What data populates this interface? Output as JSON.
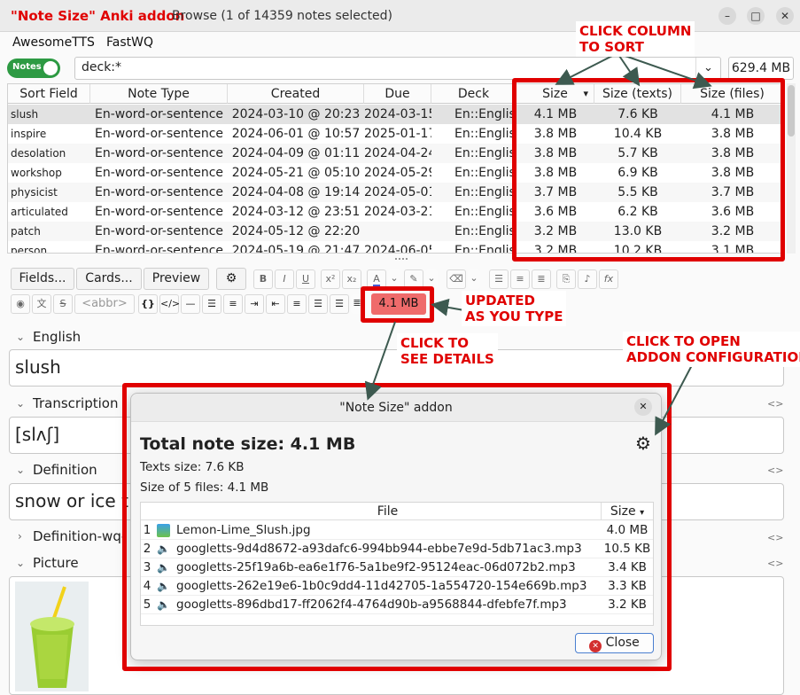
{
  "titlebar": {
    "addon_title": "\"Note Size\" Anki addon",
    "window_title": "Browse (1 of 14359 notes selected)",
    "minimize": "–",
    "maximize": "□",
    "close": "✕"
  },
  "menu": {
    "items": [
      "AwesomeTTS",
      "FastWQ"
    ]
  },
  "search": {
    "toggle_label": "Notes",
    "query": "deck:*",
    "dropdown_icon": "⌄",
    "total_size": "629.4 MB"
  },
  "table": {
    "headers": [
      "Sort Field",
      "Note Type",
      "Created",
      "Due",
      "Deck",
      "Size",
      "Size (texts)",
      "Size (files)"
    ],
    "sort_indicator": "▾",
    "rows": [
      [
        "slush",
        "En-word-or-sentence",
        "2024-03-10 @ 20:23",
        "2024-03-15",
        "En::English",
        "4.1 MB",
        "7.6 KB",
        "4.1 MB"
      ],
      [
        "inspire",
        "En-word-or-sentence",
        "2024-06-01 @ 10:57",
        "2025-01-17",
        "En::English",
        "3.8 MB",
        "10.4 KB",
        "3.8 MB"
      ],
      [
        "desolation",
        "En-word-or-sentence",
        "2024-04-09 @ 01:11",
        "2024-04-24",
        "En::English",
        "3.8 MB",
        "5.7 KB",
        "3.8 MB"
      ],
      [
        "workshop",
        "En-word-or-sentence",
        "2024-05-21 @ 05:10",
        "2024-05-29",
        "En::English",
        "3.8 MB",
        "6.9 KB",
        "3.8 MB"
      ],
      [
        "physicist",
        "En-word-or-sentence",
        "2024-04-08 @ 19:14",
        "2024-05-01",
        "En::English",
        "3.7 MB",
        "5.5 KB",
        "3.7 MB"
      ],
      [
        "articulated",
        "En-word-or-sentence",
        "2024-03-12 @ 23:51",
        "2024-03-21",
        "En::English",
        "3.6 MB",
        "6.2 KB",
        "3.6 MB"
      ],
      [
        "patch",
        "En-word-or-sentence",
        "2024-05-12 @ 22:20",
        "",
        "En::English",
        "3.2 MB",
        "13.0 KB",
        "3.2 MB"
      ],
      [
        "person",
        "En-word-or-sentence",
        "2024-05-19 @ 21:47",
        "2024-06-05",
        "En::English",
        "3.2 MB",
        "10.2 KB",
        "3.1 MB"
      ]
    ]
  },
  "editor_toolbar": {
    "fields_button": "Fields...",
    "cards_button": "Cards...",
    "preview_button": "Preview",
    "abbr_button": "<abbr>",
    "note_size_button": "4.1 MB"
  },
  "fields": [
    {
      "label": "English",
      "value": "slush"
    },
    {
      "label": "Transcription",
      "value": "[slʌʃ]"
    },
    {
      "label": "Definition",
      "value": "snow or ice t"
    },
    {
      "label": "Definition-wq-",
      "value": ""
    },
    {
      "label": "Picture",
      "value": ""
    }
  ],
  "annotations": {
    "sort": "CLICK COLUMN\nTO SORT",
    "updated": "UPDATED\nAS YOU TYPE",
    "details": "CLICK TO\nSEE DETAILS",
    "config": "CLICK TO OPEN\nADDON CONFIGURATION"
  },
  "dialog": {
    "title": "\"Note Size\" addon",
    "total": "Total note size: 4.1 MB",
    "texts": "Texts size: 7.6 KB",
    "files_summary": "Size of 5 files: 4.1 MB",
    "file_header": "File",
    "size_header": "Size",
    "files": [
      {
        "n": "1",
        "name": "Lemon-Lime_Slush.jpg",
        "size": "4.0 MB",
        "kind": "image"
      },
      {
        "n": "2",
        "name": "googletts-9d4d8672-a93dafc6-994bb944-ebbe7e9d-5db71ac3.mp3",
        "size": "10.5 KB",
        "kind": "audio"
      },
      {
        "n": "3",
        "name": "googletts-25f19a6b-ea6e1f76-5a1be9f2-95124eac-06d072b2.mp3",
        "size": "3.4 KB",
        "kind": "audio"
      },
      {
        "n": "4",
        "name": "googletts-262e19e6-1b0c9dd4-11d42705-1a554720-154e669b.mp3",
        "size": "3.3 KB",
        "kind": "audio"
      },
      {
        "n": "5",
        "name": "googletts-896dbd17-ff2062f4-4764d90b-a9568844-dfebfe7f.mp3",
        "size": "3.2 KB",
        "kind": "audio"
      }
    ],
    "close_button": "Close"
  },
  "colors": {
    "annotation_red": "#e00000",
    "note_size_badge": "#ef6b6b",
    "toggle_green": "#2d9a43"
  }
}
